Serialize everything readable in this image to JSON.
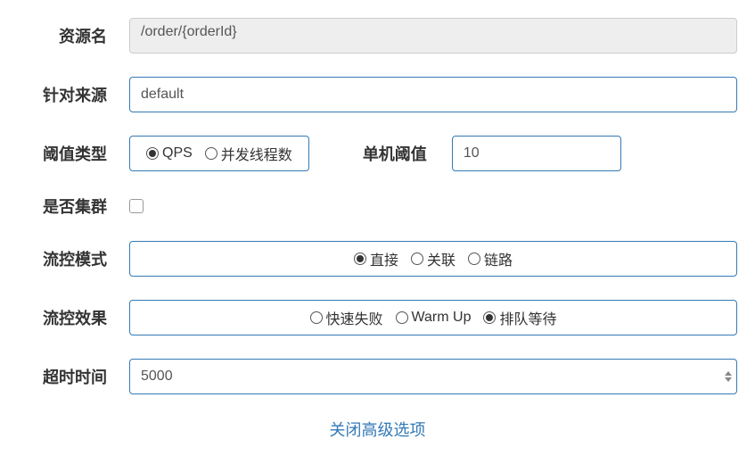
{
  "labels": {
    "resource": "资源名",
    "source": "针对来源",
    "threshold_type": "阈值类型",
    "single_threshold": "单机阈值",
    "cluster": "是否集群",
    "control_mode": "流控模式",
    "control_effect": "流控效果",
    "timeout": "超时时间"
  },
  "values": {
    "resource": "/order/{orderId}",
    "source": "default",
    "threshold": "10",
    "timeout": "5000"
  },
  "threshold_types": {
    "qps": "QPS",
    "threads": "并发线程数"
  },
  "modes": {
    "direct": "直接",
    "relate": "关联",
    "chain": "链路"
  },
  "effects": {
    "fail_fast": "快速失败",
    "warm_up": "Warm Up",
    "queue": "排队等待"
  },
  "link": "关闭高级选项"
}
